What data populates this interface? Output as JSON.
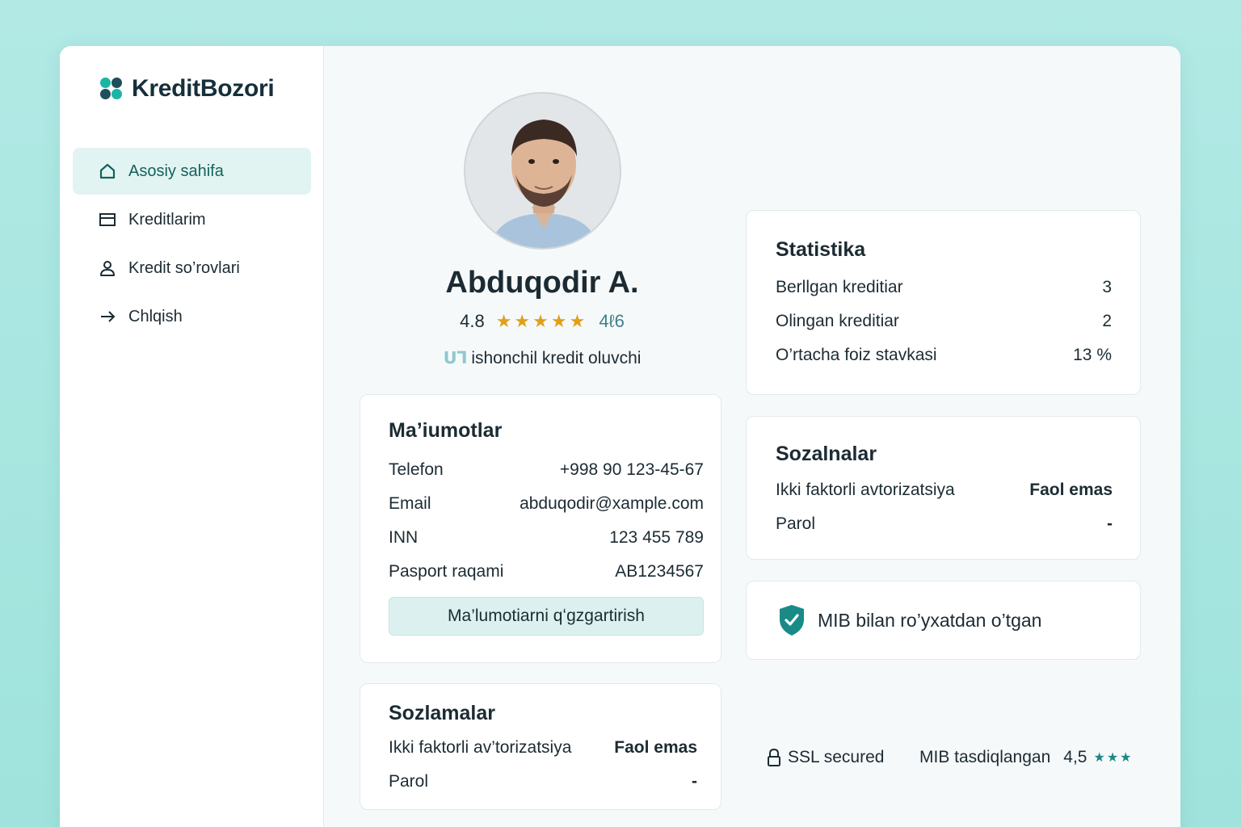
{
  "app": {
    "logo_text": "KreditBozori"
  },
  "sidebar": {
    "items": [
      {
        "label": "Asosiy sahifa",
        "icon": "home-icon",
        "active": true
      },
      {
        "label": "Kreditlarim",
        "icon": "card-icon",
        "active": false
      },
      {
        "label": "Kredit so’rovlari",
        "icon": "user-icon",
        "active": false
      },
      {
        "label": "Chlqish",
        "icon": "arrow-right-icon",
        "active": false
      }
    ]
  },
  "profile": {
    "name": "Abduqodir A.",
    "rating": "4.8",
    "rating_stars": 5,
    "reviews": "4ℓ6",
    "trust_icon": "ᑌ⅂",
    "trust_label": "ishonchil kredit oluvchi"
  },
  "info": {
    "title": "Ma’iumotlar",
    "rows": [
      {
        "label": "Telefon",
        "value": "+998 90 123-45-67"
      },
      {
        "label": "Email",
        "value": "abduqodir@xample.com"
      },
      {
        "label": "INN",
        "value": "123 455 789"
      },
      {
        "label": "Pasport raqami",
        "value": "AB1234567"
      }
    ],
    "button": "Ma’lumotiarni qʻgzgartirish"
  },
  "settings_left": {
    "title": "Sozlamalar",
    "rows": [
      {
        "label": "Ikki faktorli av’torizatsiya",
        "value": "Faol emas"
      },
      {
        "label": "Parol",
        "value": "-"
      }
    ]
  },
  "stats": {
    "title": "Statistika",
    "rows": [
      {
        "label": "Berllgan kreditiar",
        "value": "3"
      },
      {
        "label": "Olingan kreditiar",
        "value": "2"
      },
      {
        "label": "O’rtacha foiz stavkasi",
        "value": "13 %"
      }
    ]
  },
  "settings_right": {
    "title": "Sozalnalar",
    "rows": [
      {
        "label": "Ikki faktorli avtorizatsiya",
        "value": "Faol emas"
      },
      {
        "label": "Parol",
        "value": "-"
      }
    ]
  },
  "mib": {
    "label": "MIB bilan ro’yxatdan o’tgan",
    "icon": "shield-check-icon"
  },
  "footer": {
    "ssl": "SSL secured",
    "mib_label": "MIB tasdiqlangan",
    "mib_rating": "4,5",
    "mib_stars": 3
  },
  "colors": {
    "accent": "#1a8a86",
    "active_bg": "#e2f4f2",
    "star": "#e0a01a",
    "background": "#a8e6e0"
  }
}
